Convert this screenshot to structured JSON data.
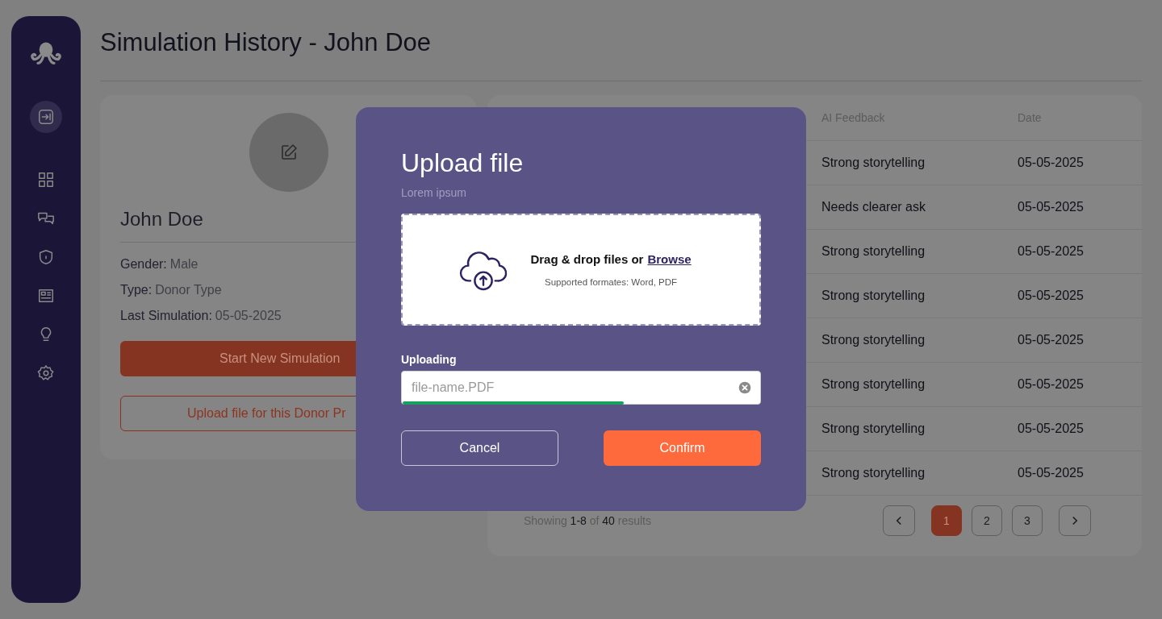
{
  "page": {
    "title": "Simulation History - John Doe"
  },
  "profile": {
    "name": "John Doe",
    "details": [
      {
        "label": "Gender:",
        "value": "Male"
      },
      {
        "label": "Type:",
        "value": "Donor Type"
      },
      {
        "label": "Last Simulation:",
        "value": "05-05-2025"
      }
    ],
    "primary_button": "Start New Simulation",
    "secondary_button": "Upload file for this Donor Pr"
  },
  "table": {
    "columns": [
      "AI Feedback",
      "Date"
    ],
    "rows": [
      {
        "ai_feedback": "Strong storytelling",
        "date": "05-05-2025"
      },
      {
        "ai_feedback": "Needs clearer ask",
        "date": "05-05-2025"
      },
      {
        "ai_feedback": "Strong storytelling",
        "date": "05-05-2025"
      },
      {
        "ai_feedback": "Strong storytelling",
        "date": "05-05-2025"
      },
      {
        "ai_feedback": "Strong storytelling",
        "date": "05-05-2025"
      },
      {
        "ai_feedback": "Strong storytelling",
        "date": "05-05-2025"
      },
      {
        "ai_feedback": "Strong storytelling",
        "date": "05-05-2025"
      },
      {
        "ai_feedback": "Strong storytelling",
        "date": "05-05-2025"
      }
    ],
    "pagination": {
      "summary": "Showing **1-8** of **40** results",
      "pages": [
        {
          "label": "1",
          "selected": true
        },
        {
          "label": "2",
          "selected": false
        },
        {
          "label": "3",
          "selected": false
        }
      ]
    }
  },
  "modal": {
    "title": "Upload file",
    "subtitle": "Lorem ipsum",
    "dropzone": {
      "prompt": "Drag & drop files or",
      "link": "Browse",
      "formats": "Supported formates: Word, PDF"
    },
    "upload_label": "Uploading",
    "file_field": {
      "placeholder": "file-name.PDF"
    },
    "progress": {
      "level": 0.62
    },
    "cancel": "Cancel",
    "confirm": "Confirm"
  }
}
